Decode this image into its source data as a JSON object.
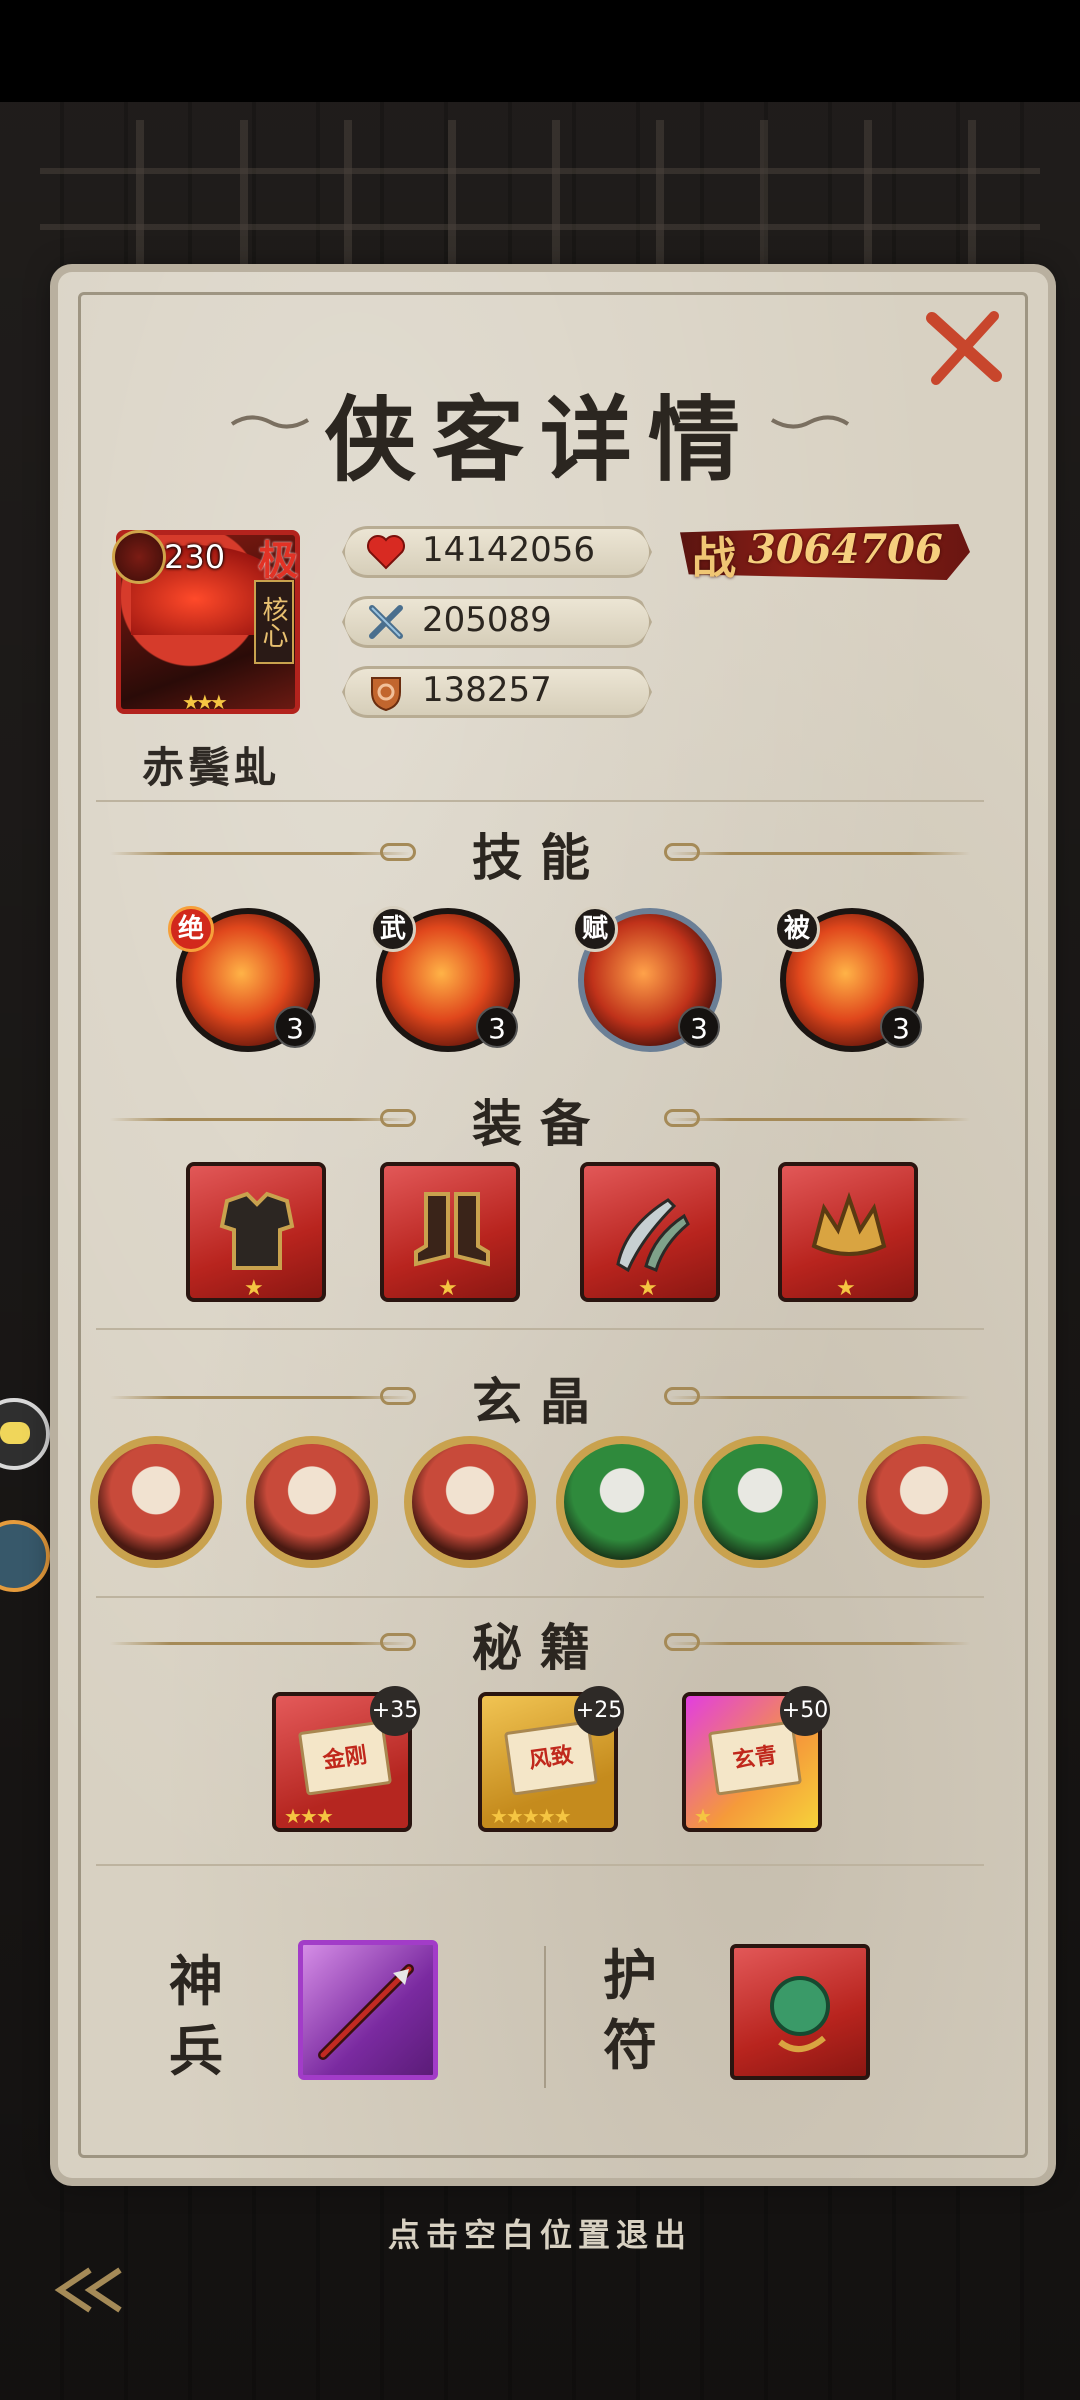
{
  "dialog": {
    "title": "侠客详情",
    "exit_hint": "点击空白位置退出"
  },
  "hero": {
    "name": "赤鬓虬",
    "level": "230",
    "grade": "极",
    "core": "核心",
    "stars": "★★★"
  },
  "stats": {
    "hp": "14142056",
    "attack": "205089",
    "defense": "138257",
    "power_label": "战",
    "power_value": "3064706"
  },
  "sections": {
    "skills": "技能",
    "equipment": "装备",
    "crystals": "玄晶",
    "manuals": "秘籍",
    "weapon": "神兵",
    "amulet": "护符"
  },
  "skills": [
    {
      "tag": "绝",
      "level": "3"
    },
    {
      "tag": "武",
      "level": "3"
    },
    {
      "tag": "赋",
      "level": "3"
    },
    {
      "tag": "被",
      "level": "3"
    }
  ],
  "manuals": [
    {
      "title": "金刚",
      "plus": "+35",
      "stars": "★★★"
    },
    {
      "title": "风致",
      "plus": "+25",
      "stars": "★★★★★"
    },
    {
      "title": "玄青",
      "plus": "+50",
      "stars": "★"
    }
  ],
  "equipment_stars": [
    "★",
    "★",
    "★",
    "★"
  ],
  "colors": {
    "paper": "#d8d1c2",
    "accent_red": "#b3231d",
    "gold": "#c9a24e",
    "weapon_purple": "#a23cc8"
  }
}
